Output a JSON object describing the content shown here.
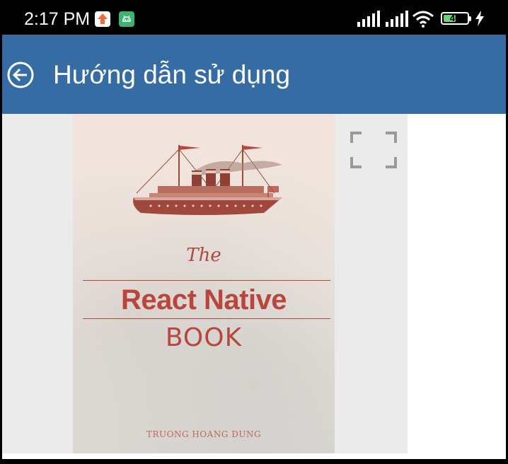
{
  "status_bar": {
    "time": "2:17 PM",
    "battery_level": "46",
    "icons": [
      "upload-notification-icon",
      "android-debug-icon",
      "signal-icon",
      "signal-icon",
      "wifi-icon",
      "battery-icon",
      "charging-icon"
    ]
  },
  "app_bar": {
    "title": "Hướng dẫn sử dụng",
    "back_icon": "arrow-left-circle-icon",
    "color": "#356ca4"
  },
  "book": {
    "the": "The",
    "title": "React Native",
    "subtitle": "BOOK",
    "author": "TRUONG HOANG DUNG",
    "accent_color": "#b9463c"
  },
  "viewer": {
    "fullscreen_icon": "fullscreen-icon"
  }
}
